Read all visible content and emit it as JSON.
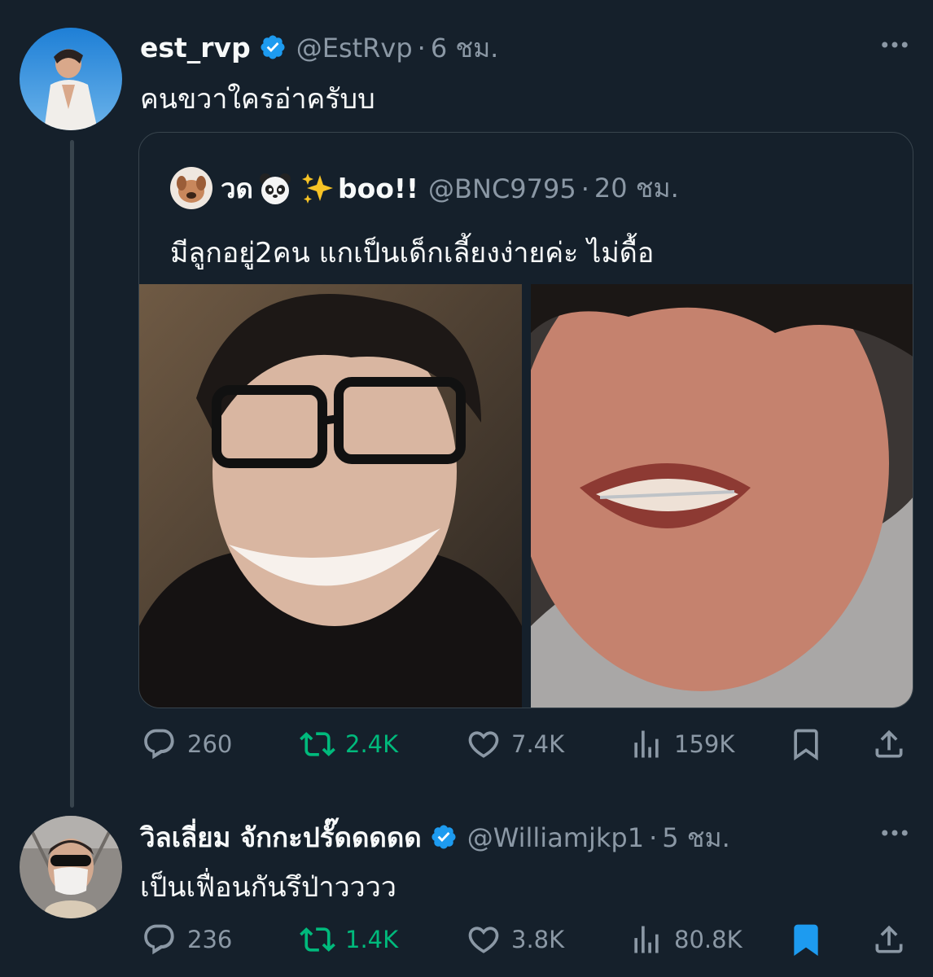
{
  "tweet1": {
    "name": "est_rvp",
    "handle": "@EstRvp",
    "separator": "·",
    "time": "6 ชม.",
    "text": "คนขวาใครอ่าครับบ",
    "more_icon": "more-horizontal-icon",
    "quote": {
      "name": "วด",
      "name_suffix": "boo!!",
      "emojis": [
        "panda-emoji",
        "sparkles-emoji"
      ],
      "handle": "@BNC9795",
      "separator": "·",
      "time": "20 ชม.",
      "text": "มีลูกอยู่2คน แกเป็นเด็กเลี้ยงง่ายค่ะ ไม่ดื้อ"
    },
    "actions": {
      "replies": "260",
      "retweets": "2.4K",
      "likes": "7.4K",
      "views": "159K"
    }
  },
  "tweet2": {
    "name": "วิลเลี่ยม จักกะปรั๊ดดดดด",
    "handle": "@Williamjkp1",
    "separator": "·",
    "time": "5 ชม.",
    "text": "เป็นเฟื่อนกันรึป่าวววว",
    "more_icon": "more-horizontal-icon",
    "actions": {
      "replies": "236",
      "retweets": "1.4K",
      "likes": "3.8K",
      "views": "80.8K",
      "bookmarked": true
    }
  },
  "colors": {
    "background": "#15202b",
    "text_primary": "#f7f9f9",
    "text_secondary": "#8b98a5",
    "verified_blue": "#1d9bf0",
    "retweet_green": "#00ba7c",
    "bookmark_active": "#1d9bf0",
    "border": "#38444d"
  }
}
